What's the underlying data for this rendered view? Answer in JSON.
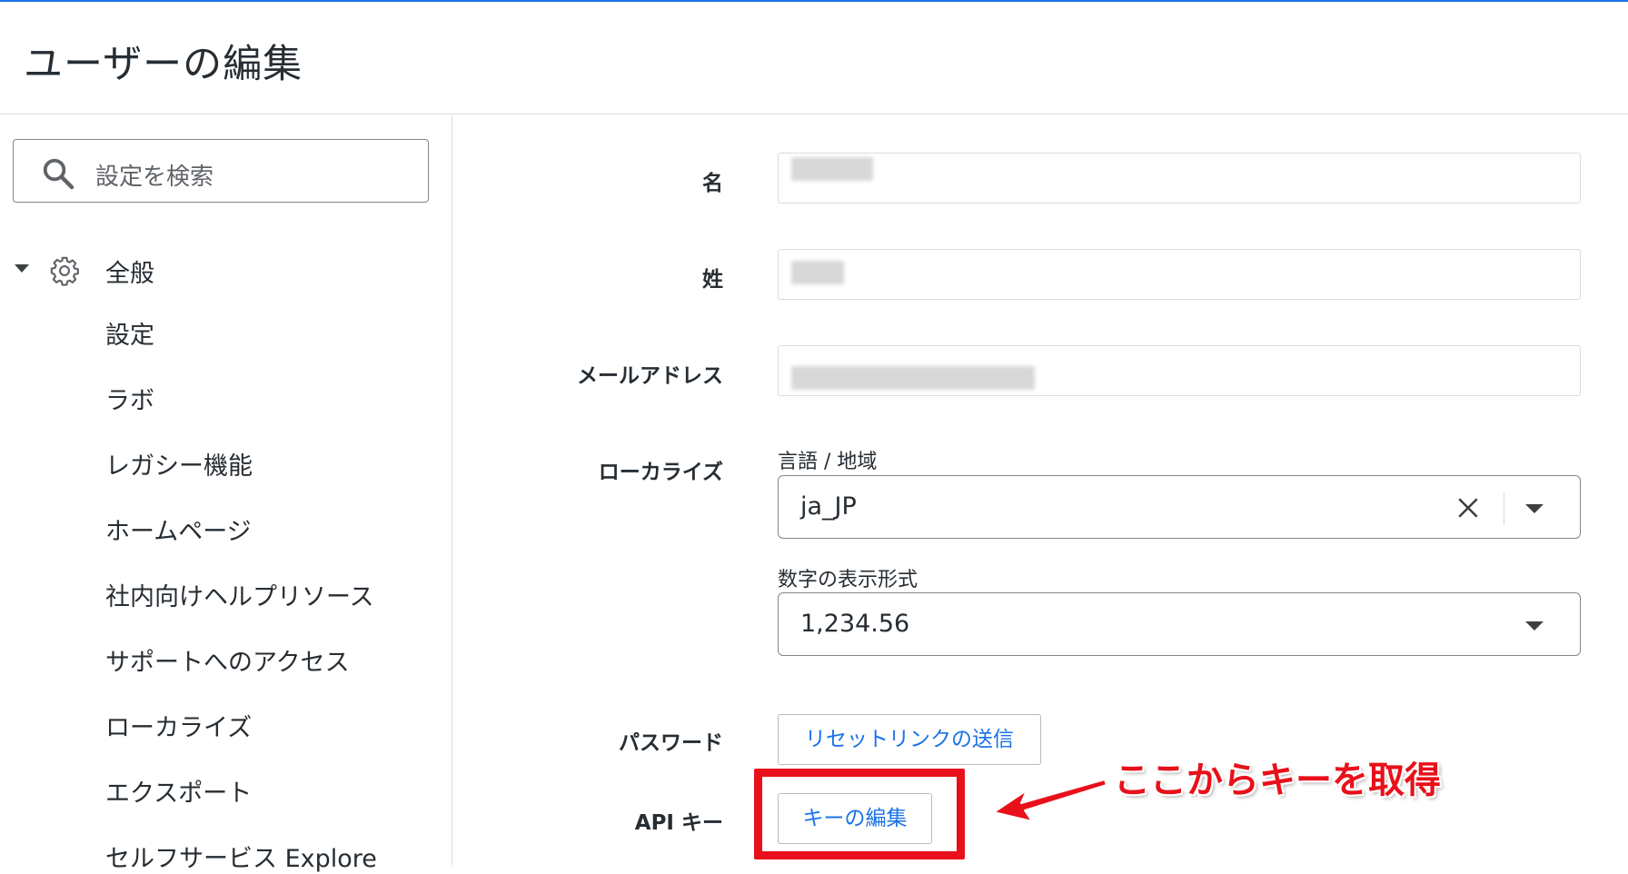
{
  "header": {
    "title": "ユーザーの編集"
  },
  "sidebar": {
    "search_placeholder": "設定を検索",
    "group": {
      "label": "全般",
      "expanded": true,
      "icon": "gear-icon"
    },
    "items": [
      {
        "label": "設定"
      },
      {
        "label": "ラボ"
      },
      {
        "label": "レガシー機能"
      },
      {
        "label": "ホームページ"
      },
      {
        "label": "社内向けヘルプリソース"
      },
      {
        "label": "サポートへのアクセス"
      },
      {
        "label": "ローカライズ"
      },
      {
        "label": "エクスポート"
      },
      {
        "label": "セルフサービス Explore"
      }
    ]
  },
  "form": {
    "first_name": {
      "label": "名",
      "value": ""
    },
    "last_name": {
      "label": "姓",
      "value": ""
    },
    "email": {
      "label": "メールアドレス",
      "value": ""
    },
    "localization": {
      "label": "ローカライズ",
      "locale_label": "言語 / 地域",
      "locale_value": "ja_JP",
      "number_format_label": "数字の表示形式",
      "number_format_value": "1,234.56"
    },
    "password": {
      "label": "パスワード",
      "button": "リセットリンクの送信"
    },
    "api_key": {
      "label": "API キー",
      "button": "キーの編集"
    }
  },
  "annotation": {
    "text": "ここからキーを取得",
    "color": "#e8101a"
  },
  "colors": {
    "link": "#1a73e8",
    "accent_line": "#1a73e8"
  }
}
